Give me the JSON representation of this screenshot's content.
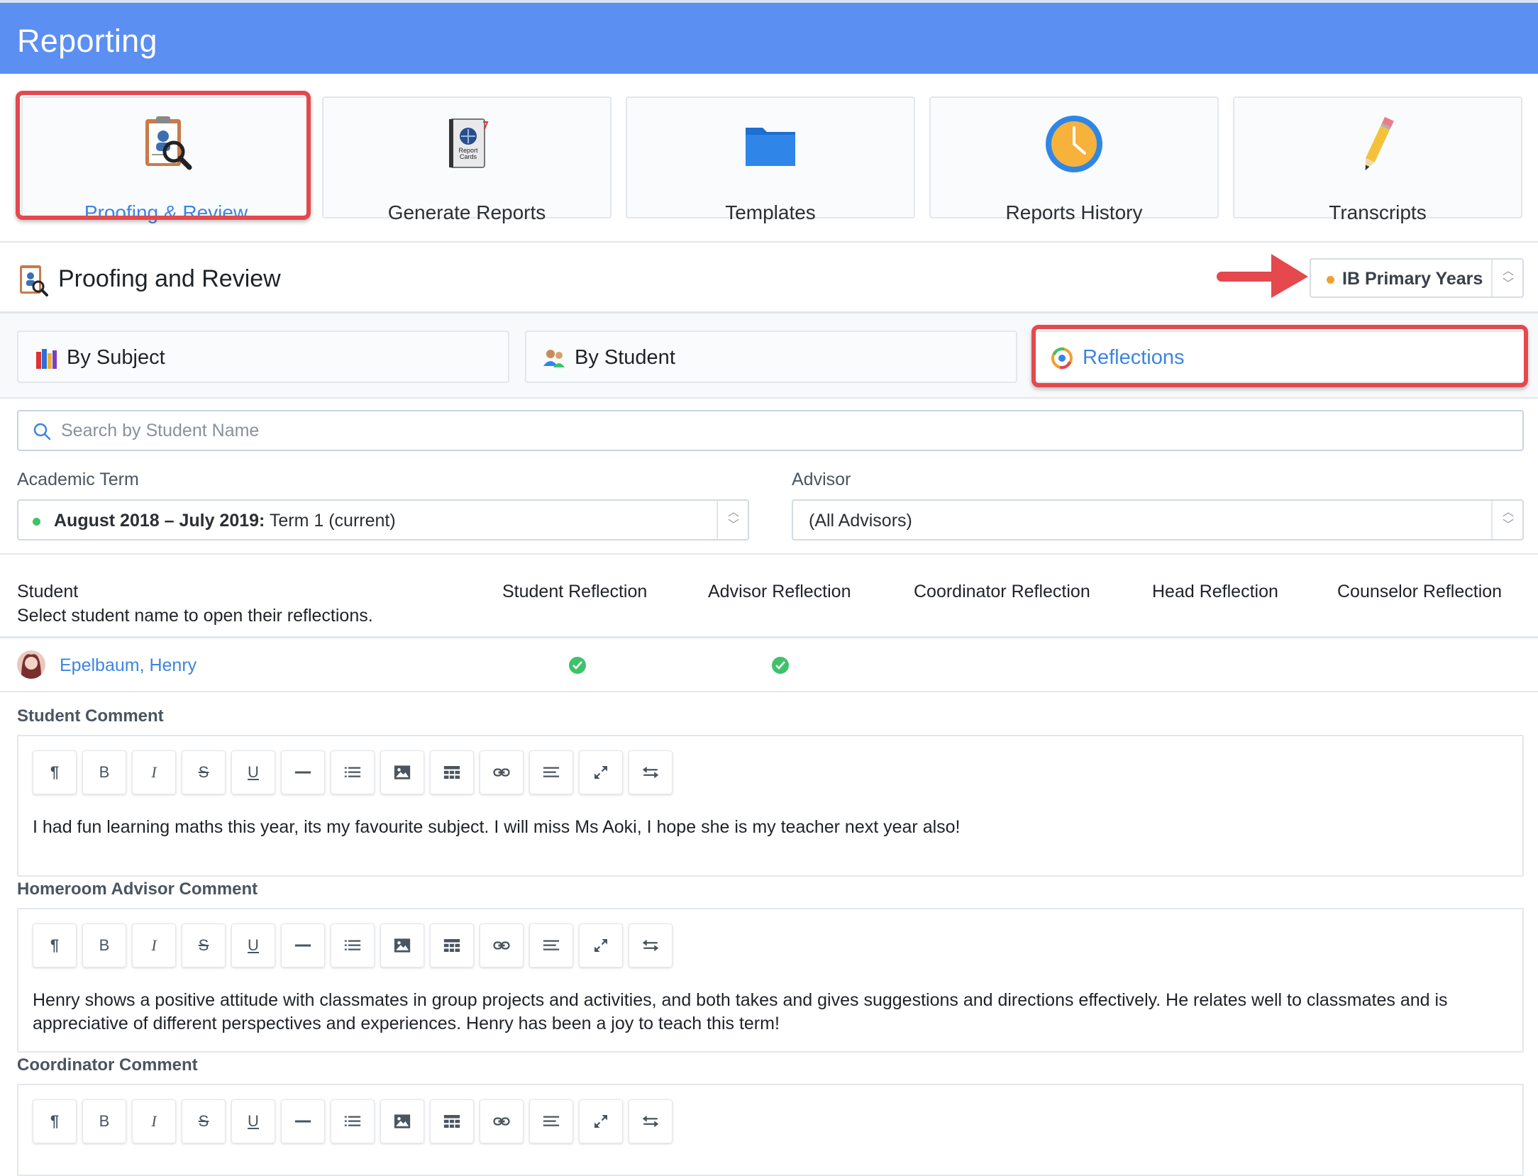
{
  "header": {
    "title": "Reporting"
  },
  "tiles": [
    {
      "label": "Proofing & Review",
      "icon": "clipboard-magnifier-icon"
    },
    {
      "label": "Generate Reports",
      "icon": "report-cards-book-icon"
    },
    {
      "label": "Templates",
      "icon": "folder-icon"
    },
    {
      "label": "Reports History",
      "icon": "clock-icon"
    },
    {
      "label": "Transcripts",
      "icon": "pencil-icon"
    }
  ],
  "section": {
    "title": "Proofing and Review",
    "program": "IB Primary Years"
  },
  "tabs": [
    {
      "label": "By Subject",
      "icon": "books-icon"
    },
    {
      "label": "By Student",
      "icon": "users-icon"
    },
    {
      "label": "Reflections",
      "icon": "reflections-icon"
    }
  ],
  "search": {
    "placeholder": "Search by Student Name"
  },
  "filters": {
    "term_label": "Academic Term",
    "term_bold": "August 2018 – July 2019:",
    "term_rest": "Term 1 (current)",
    "advisor_label": "Advisor",
    "advisor_value": "(All Advisors)"
  },
  "list": {
    "col_student": "Student",
    "col_student_hint": "Select student name to open their reflections.",
    "columns": [
      "Student Reflection",
      "Advisor Reflection",
      "Coordinator Reflection",
      "Head Reflection",
      "Counselor Reflection"
    ],
    "student": {
      "name": "Epelbaum, Henry",
      "student_reflection": true,
      "advisor_reflection": true
    }
  },
  "comments": [
    {
      "label": "Student Comment",
      "text": "I had fun learning maths this year, its my favourite subject. I will miss Ms Aoki, I hope she is my teacher next year also!"
    },
    {
      "label": "Homeroom Advisor Comment",
      "text": "Henry shows a positive attitude with classmates in group projects and activities, and both takes and gives suggestions and directions effectively. He relates well to classmates and is appreciative of different perspectives and experiences. Henry has been a joy to teach this term!"
    },
    {
      "label": "Coordinator Comment",
      "text": ""
    }
  ],
  "toolbar": [
    {
      "name": "paragraph-icon",
      "glyph": "¶"
    },
    {
      "name": "bold-icon",
      "glyph": "B"
    },
    {
      "name": "italic-icon",
      "glyph": "I"
    },
    {
      "name": "strikethrough-icon",
      "glyph": "S"
    },
    {
      "name": "underline-icon",
      "glyph": "U"
    },
    {
      "name": "horizontal-rule-icon",
      "glyph": ""
    },
    {
      "name": "list-icon",
      "glyph": ""
    },
    {
      "name": "image-icon",
      "glyph": ""
    },
    {
      "name": "table-icon",
      "glyph": ""
    },
    {
      "name": "link-icon",
      "glyph": ""
    },
    {
      "name": "align-icon",
      "glyph": ""
    },
    {
      "name": "fullscreen-icon",
      "glyph": ""
    },
    {
      "name": "swap-icon",
      "glyph": ""
    }
  ],
  "colors": {
    "header": "#5b8ff2",
    "accent": "#3d85e0",
    "highlight": "#e5484d",
    "check": "#3ec26a"
  }
}
